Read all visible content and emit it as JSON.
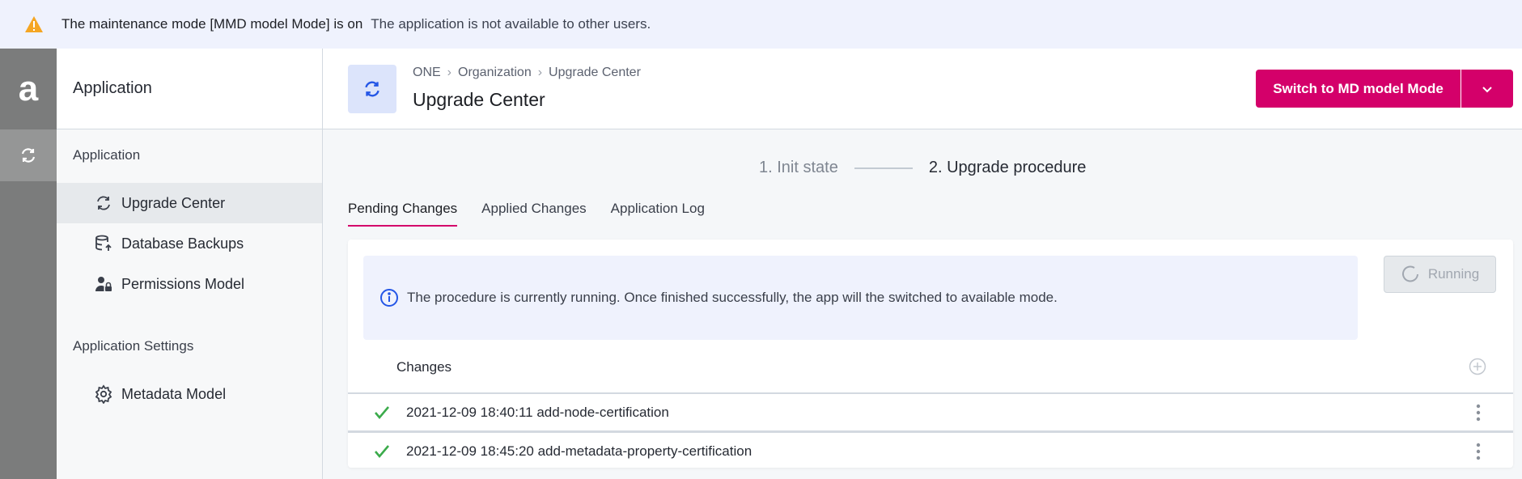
{
  "banner": {
    "icon": "warning-icon",
    "title": "The maintenance mode [MMD model Mode] is on",
    "message": "The application is not available to other users.",
    "icon_color": "#f5a623"
  },
  "rail": {
    "logo": "a",
    "active_icon": "sync-icon"
  },
  "sidebar": {
    "header": "Application",
    "sections": [
      {
        "title": "Application",
        "items": [
          {
            "label": "Upgrade Center",
            "icon": "sync-icon",
            "active": true
          },
          {
            "label": "Database Backups",
            "icon": "database-upload-icon"
          },
          {
            "label": "Permissions Model",
            "icon": "user-lock-icon"
          }
        ]
      },
      {
        "title": "Application Settings",
        "items": [
          {
            "label": "Metadata Model",
            "icon": "gear-icon"
          }
        ]
      }
    ]
  },
  "header": {
    "breadcrumb": [
      "ONE",
      "Organization",
      "Upgrade Center"
    ],
    "title": "Upgrade Center",
    "switch_label": "Switch to MD model Mode",
    "accent": "#d4006a"
  },
  "stepper": {
    "step1": "1. Init state",
    "step2": "2. Upgrade procedure"
  },
  "tabs": [
    {
      "label": "Pending Changes",
      "active": true
    },
    {
      "label": "Applied Changes"
    },
    {
      "label": "Application Log"
    }
  ],
  "info": {
    "message": "The procedure is currently running. Once finished successfully, the app will the switched to available mode."
  },
  "running_label": "Running",
  "changes": {
    "title": "Changes",
    "rows": [
      {
        "text": "2021-12-09 18:40:11 add-node-certification",
        "status": "success"
      },
      {
        "text": "2021-12-09 18:45:20 add-metadata-property-certification",
        "status": "success"
      }
    ]
  }
}
